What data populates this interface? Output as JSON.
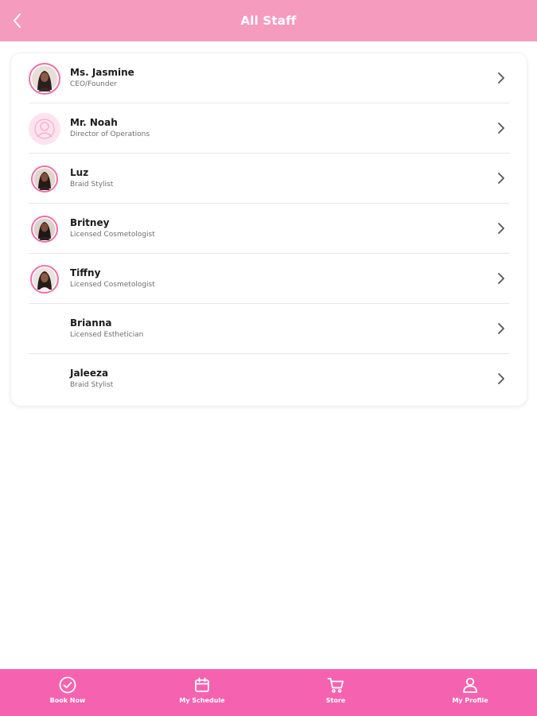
{
  "header": {
    "title": "All Staff",
    "back_icon": "chevron-left-icon"
  },
  "staff": [
    {
      "name": "Ms. Jasmine",
      "role": "CEO/Founder",
      "avatar": "photo"
    },
    {
      "name": "Mr. Noah",
      "role": "Director of Operations",
      "avatar": "placeholder"
    },
    {
      "name": "Luz",
      "role": "Braid Stylist",
      "avatar": "photo"
    },
    {
      "name": "Britney",
      "role": "Licensed Cosmetologist",
      "avatar": "photo"
    },
    {
      "name": "Tiffny",
      "role": "Licensed Cosmetologist",
      "avatar": "photo"
    },
    {
      "name": "Brianna",
      "role": "Licensed Esthetician",
      "avatar": "none"
    },
    {
      "name": "Jaleeza",
      "role": "Braid Stylist",
      "avatar": "none"
    }
  ],
  "nav": {
    "items": [
      {
        "label": "Book Now",
        "icon": "check-circle-icon"
      },
      {
        "label": "My Schedule",
        "icon": "calendar-icon"
      },
      {
        "label": "Store",
        "icon": "cart-icon"
      },
      {
        "label": "My Profile",
        "icon": "user-icon"
      }
    ]
  },
  "colors": {
    "header": "#f59cbe",
    "bottom_nav": "#f563b0",
    "avatar_ring": "#f06fa9",
    "placeholder_bg": "#fce3ee"
  }
}
